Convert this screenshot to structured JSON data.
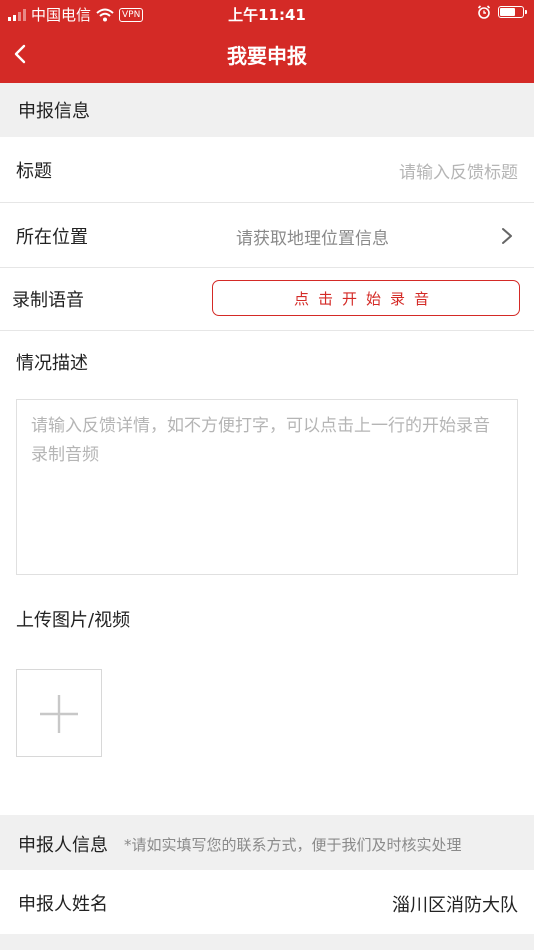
{
  "status_bar": {
    "carrier": "中国电信",
    "vpn": "VPN",
    "time": "上午11:41",
    "battery_level": 0.7
  },
  "nav": {
    "title": "我要申报"
  },
  "report_section": {
    "header": "申报信息",
    "title_label": "标题",
    "title_placeholder": "请输入反馈标题",
    "location_label": "所在位置",
    "location_placeholder": "请获取地理位置信息",
    "voice_label": "录制语音",
    "record_button": "点击开始录音",
    "description_label": "情况描述",
    "description_placeholder": "请输入反馈详情，如不方便打字，可以点击上一行的开始录音 录制音频",
    "upload_label": "上传图片/视频"
  },
  "reporter_section": {
    "header": "申报人信息",
    "hint": "*请如实填写您的联系方式，便于我们及时核实处理",
    "name_label": "申报人姓名",
    "name_value": "淄川区消防大队"
  },
  "colors": {
    "accent": "#d42a26",
    "section_bg": "#f0f0f0",
    "placeholder": "#b5b5b5"
  }
}
